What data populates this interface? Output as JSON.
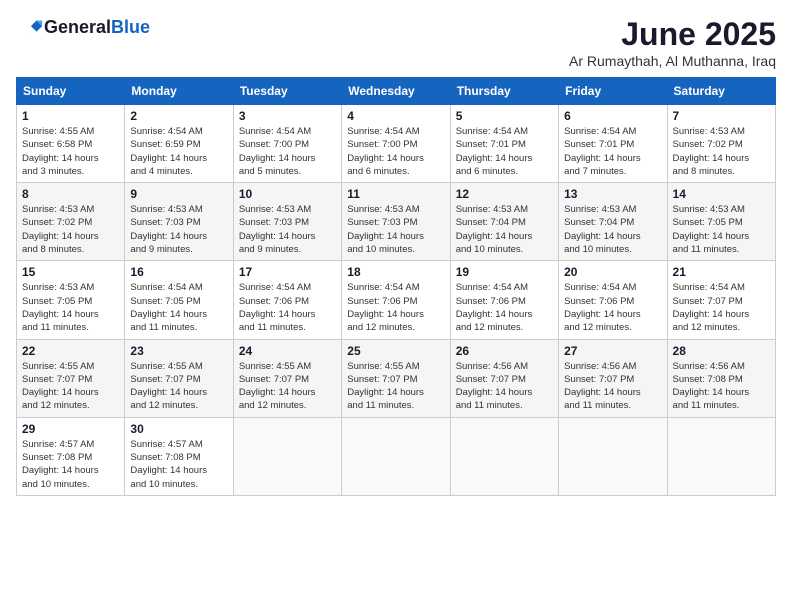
{
  "header": {
    "logo_general": "General",
    "logo_blue": "Blue",
    "month_title": "June 2025",
    "location": "Ar Rumaythah, Al Muthanna, Iraq"
  },
  "days_of_week": [
    "Sunday",
    "Monday",
    "Tuesday",
    "Wednesday",
    "Thursday",
    "Friday",
    "Saturday"
  ],
  "weeks": [
    [
      {
        "day": "1",
        "sunrise": "4:55 AM",
        "sunset": "6:58 PM",
        "daylight": "14 hours and 3 minutes."
      },
      {
        "day": "2",
        "sunrise": "4:54 AM",
        "sunset": "6:59 PM",
        "daylight": "14 hours and 4 minutes."
      },
      {
        "day": "3",
        "sunrise": "4:54 AM",
        "sunset": "7:00 PM",
        "daylight": "14 hours and 5 minutes."
      },
      {
        "day": "4",
        "sunrise": "4:54 AM",
        "sunset": "7:00 PM",
        "daylight": "14 hours and 6 minutes."
      },
      {
        "day": "5",
        "sunrise": "4:54 AM",
        "sunset": "7:01 PM",
        "daylight": "14 hours and 6 minutes."
      },
      {
        "day": "6",
        "sunrise": "4:54 AM",
        "sunset": "7:01 PM",
        "daylight": "14 hours and 7 minutes."
      },
      {
        "day": "7",
        "sunrise": "4:53 AM",
        "sunset": "7:02 PM",
        "daylight": "14 hours and 8 minutes."
      }
    ],
    [
      {
        "day": "8",
        "sunrise": "4:53 AM",
        "sunset": "7:02 PM",
        "daylight": "14 hours and 8 minutes."
      },
      {
        "day": "9",
        "sunrise": "4:53 AM",
        "sunset": "7:03 PM",
        "daylight": "14 hours and 9 minutes."
      },
      {
        "day": "10",
        "sunrise": "4:53 AM",
        "sunset": "7:03 PM",
        "daylight": "14 hours and 9 minutes."
      },
      {
        "day": "11",
        "sunrise": "4:53 AM",
        "sunset": "7:03 PM",
        "daylight": "14 hours and 10 minutes."
      },
      {
        "day": "12",
        "sunrise": "4:53 AM",
        "sunset": "7:04 PM",
        "daylight": "14 hours and 10 minutes."
      },
      {
        "day": "13",
        "sunrise": "4:53 AM",
        "sunset": "7:04 PM",
        "daylight": "14 hours and 10 minutes."
      },
      {
        "day": "14",
        "sunrise": "4:53 AM",
        "sunset": "7:05 PM",
        "daylight": "14 hours and 11 minutes."
      }
    ],
    [
      {
        "day": "15",
        "sunrise": "4:53 AM",
        "sunset": "7:05 PM",
        "daylight": "14 hours and 11 minutes."
      },
      {
        "day": "16",
        "sunrise": "4:54 AM",
        "sunset": "7:05 PM",
        "daylight": "14 hours and 11 minutes."
      },
      {
        "day": "17",
        "sunrise": "4:54 AM",
        "sunset": "7:06 PM",
        "daylight": "14 hours and 11 minutes."
      },
      {
        "day": "18",
        "sunrise": "4:54 AM",
        "sunset": "7:06 PM",
        "daylight": "14 hours and 12 minutes."
      },
      {
        "day": "19",
        "sunrise": "4:54 AM",
        "sunset": "7:06 PM",
        "daylight": "14 hours and 12 minutes."
      },
      {
        "day": "20",
        "sunrise": "4:54 AM",
        "sunset": "7:06 PM",
        "daylight": "14 hours and 12 minutes."
      },
      {
        "day": "21",
        "sunrise": "4:54 AM",
        "sunset": "7:07 PM",
        "daylight": "14 hours and 12 minutes."
      }
    ],
    [
      {
        "day": "22",
        "sunrise": "4:55 AM",
        "sunset": "7:07 PM",
        "daylight": "14 hours and 12 minutes."
      },
      {
        "day": "23",
        "sunrise": "4:55 AM",
        "sunset": "7:07 PM",
        "daylight": "14 hours and 12 minutes."
      },
      {
        "day": "24",
        "sunrise": "4:55 AM",
        "sunset": "7:07 PM",
        "daylight": "14 hours and 12 minutes."
      },
      {
        "day": "25",
        "sunrise": "4:55 AM",
        "sunset": "7:07 PM",
        "daylight": "14 hours and 11 minutes."
      },
      {
        "day": "26",
        "sunrise": "4:56 AM",
        "sunset": "7:07 PM",
        "daylight": "14 hours and 11 minutes."
      },
      {
        "day": "27",
        "sunrise": "4:56 AM",
        "sunset": "7:07 PM",
        "daylight": "14 hours and 11 minutes."
      },
      {
        "day": "28",
        "sunrise": "4:56 AM",
        "sunset": "7:08 PM",
        "daylight": "14 hours and 11 minutes."
      }
    ],
    [
      {
        "day": "29",
        "sunrise": "4:57 AM",
        "sunset": "7:08 PM",
        "daylight": "14 hours and 10 minutes."
      },
      {
        "day": "30",
        "sunrise": "4:57 AM",
        "sunset": "7:08 PM",
        "daylight": "14 hours and 10 minutes."
      },
      null,
      null,
      null,
      null,
      null
    ]
  ],
  "labels": {
    "sunrise": "Sunrise:",
    "sunset": "Sunset:",
    "daylight": "Daylight hours"
  }
}
